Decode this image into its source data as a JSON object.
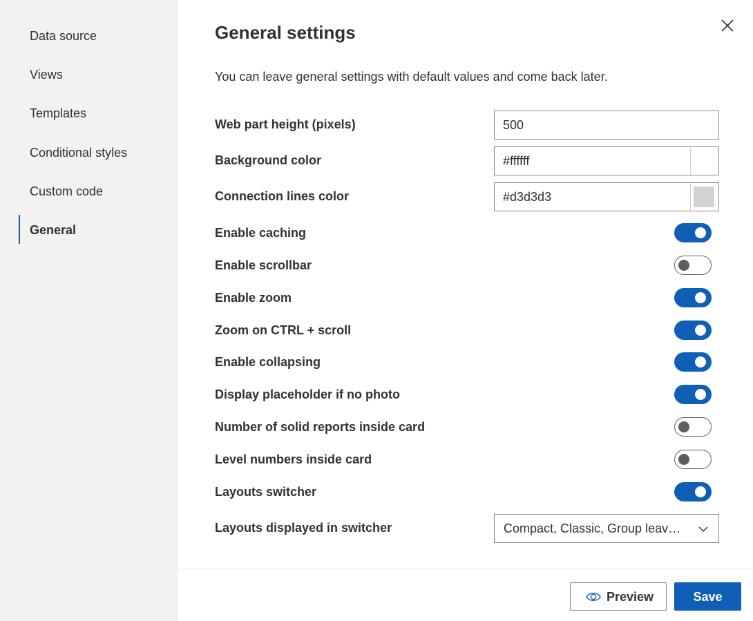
{
  "sidebar": {
    "items": [
      {
        "label": "Data source"
      },
      {
        "label": "Views"
      },
      {
        "label": "Templates"
      },
      {
        "label": "Conditional styles"
      },
      {
        "label": "Custom code"
      },
      {
        "label": "General",
        "active": true
      }
    ]
  },
  "header": {
    "title": "General settings",
    "subtitle": "You can leave general settings with default values and come back later.",
    "close_icon": "close-icon"
  },
  "fields": {
    "height": {
      "label": "Web part height (pixels)",
      "value": "500"
    },
    "background": {
      "label": "Background color",
      "value": "#ffffff",
      "swatch": "#ffffff"
    },
    "lines": {
      "label": "Connection lines color",
      "value": "#d3d3d3",
      "swatch": "#d3d3d3"
    }
  },
  "toggles": [
    {
      "label": "Enable caching",
      "on": true
    },
    {
      "label": "Enable scrollbar",
      "on": false
    },
    {
      "label": "Enable zoom",
      "on": true
    },
    {
      "label": "Zoom on CTRL + scroll",
      "on": true
    },
    {
      "label": "Enable collapsing",
      "on": true
    },
    {
      "label": "Display placeholder if no photo",
      "on": true
    },
    {
      "label": "Number of solid reports inside card",
      "on": false
    },
    {
      "label": "Level numbers inside card",
      "on": false
    },
    {
      "label": "Layouts switcher",
      "on": true
    }
  ],
  "layouts_dropdown": {
    "label": "Layouts displayed in switcher",
    "value": "Compact, Classic, Group leav…",
    "icon": "chevron-down-icon"
  },
  "footer": {
    "preview_label": "Preview",
    "preview_icon": "eye-icon",
    "save_label": "Save"
  },
  "colors": {
    "accent": "#0f5fb7",
    "sidebar_bg": "#f3f2f1",
    "text": "#323130"
  }
}
